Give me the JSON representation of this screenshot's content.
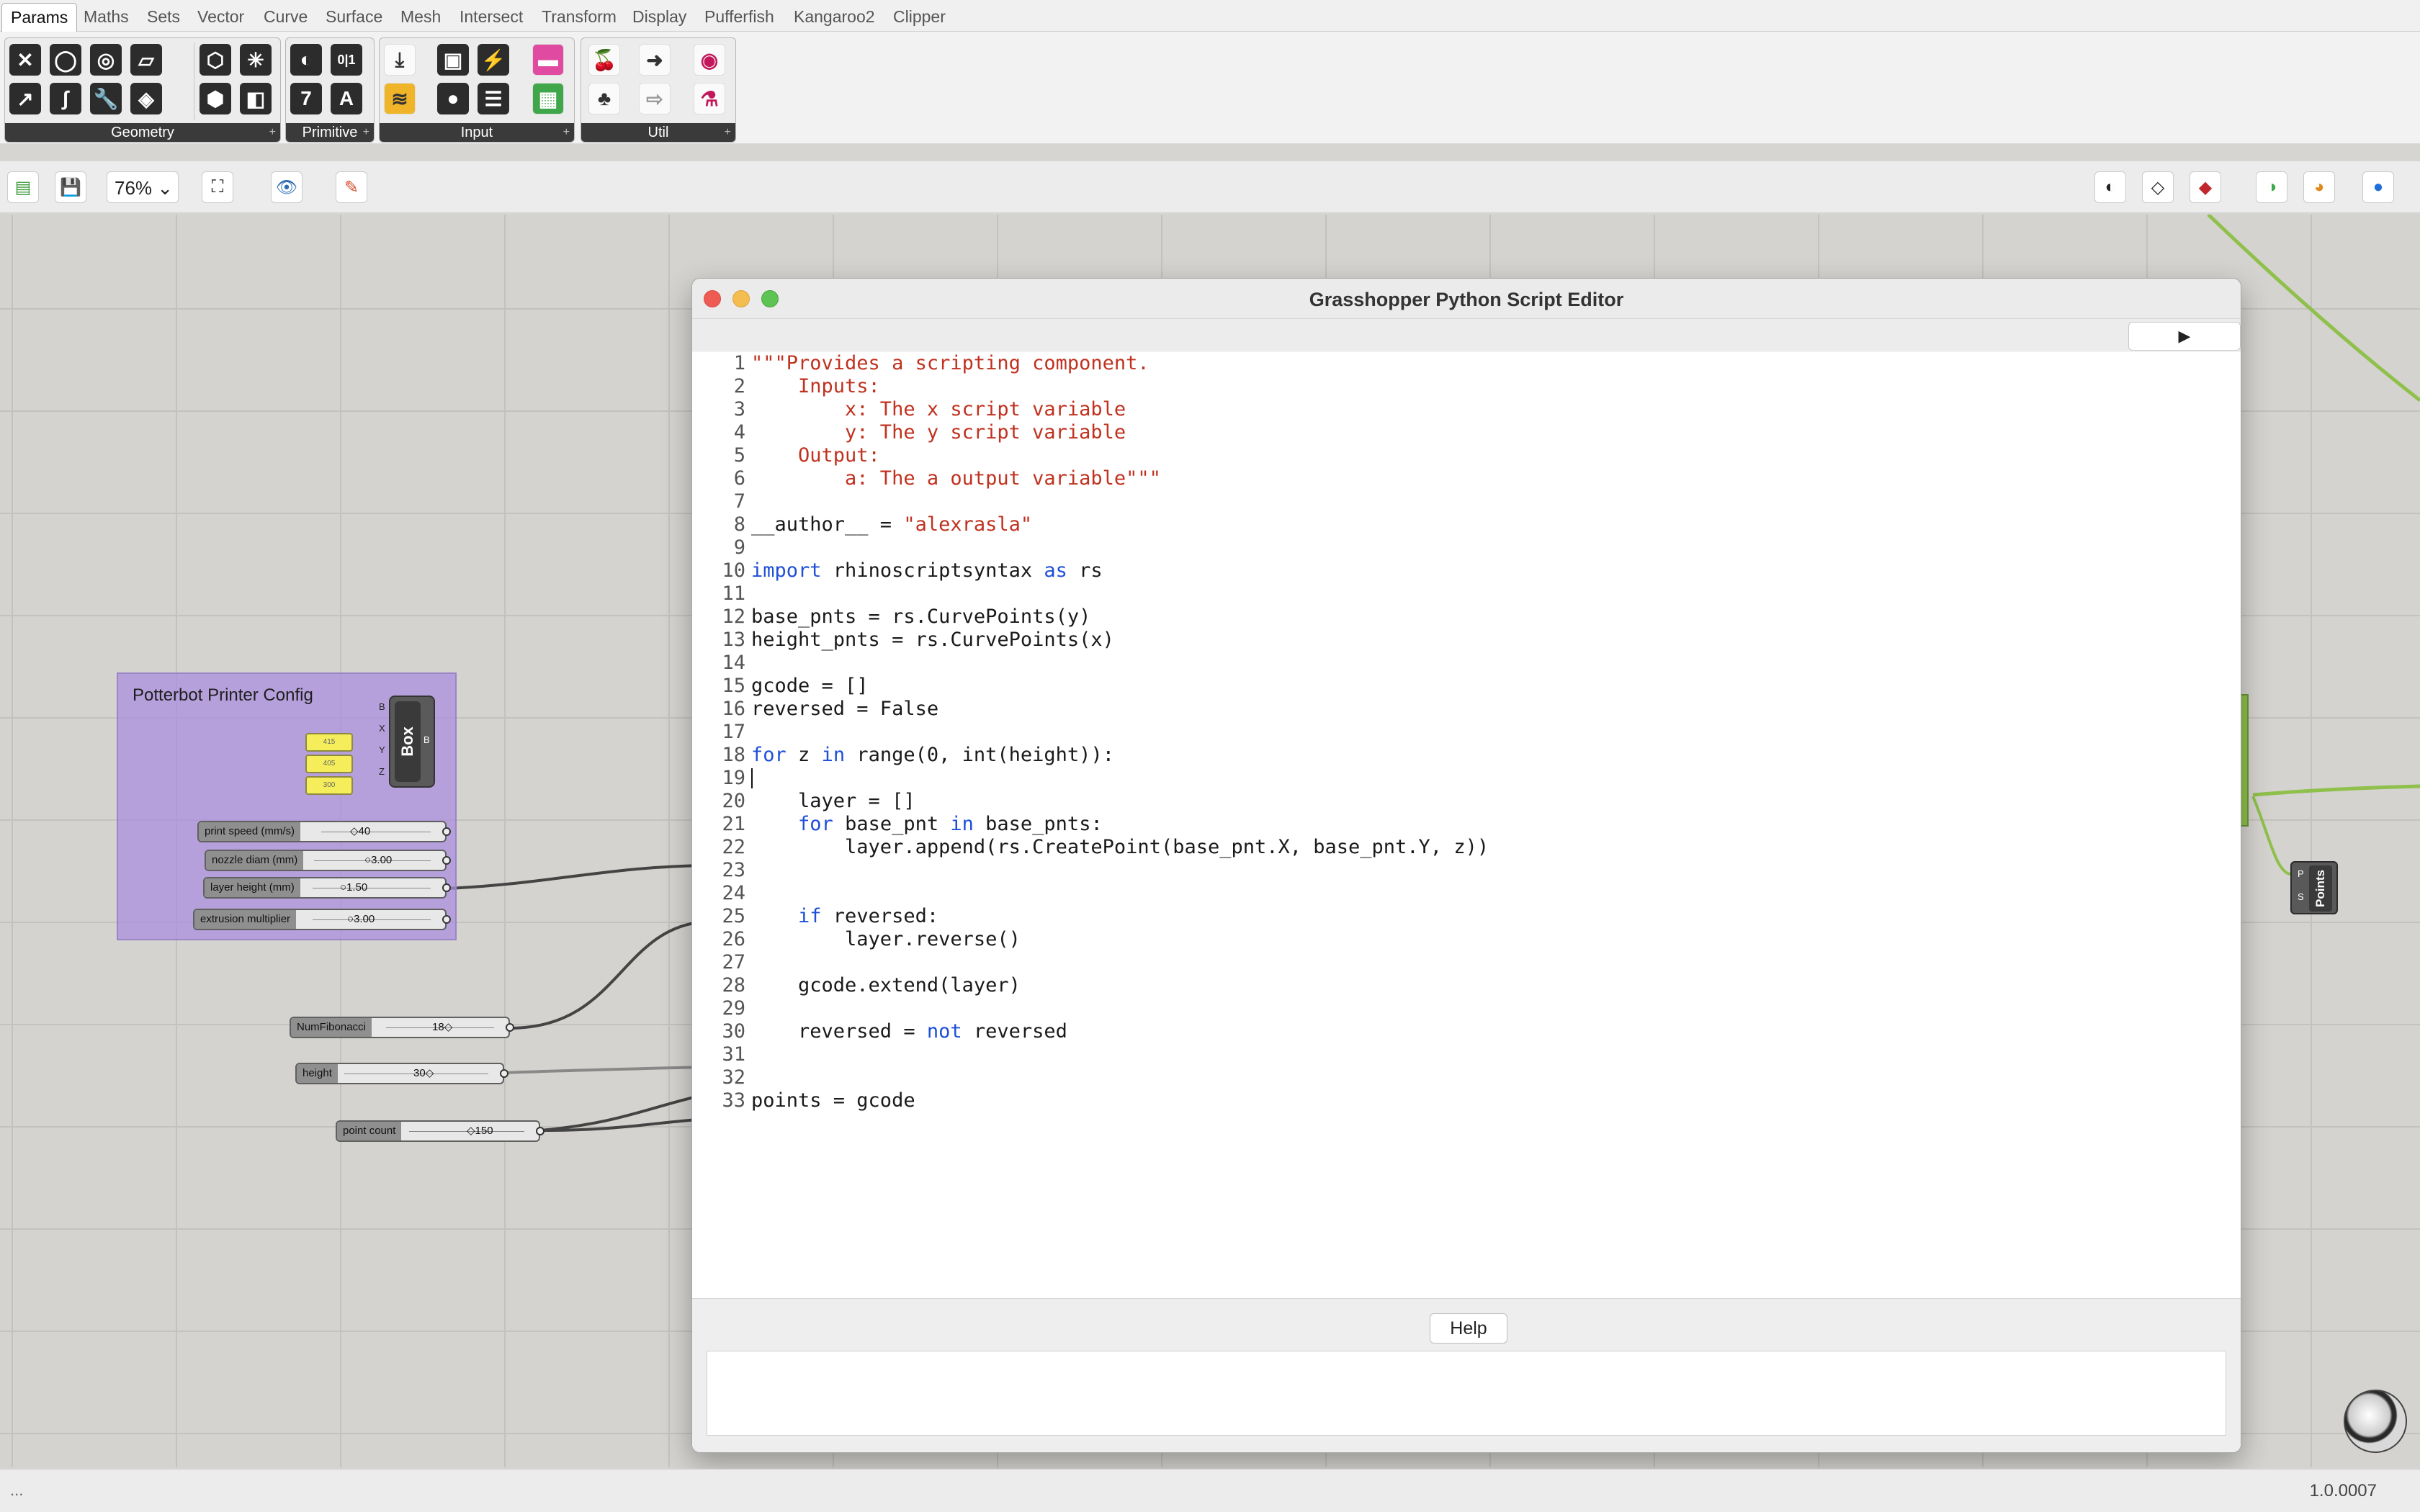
{
  "menu_tabs": [
    "Params",
    "Maths",
    "Sets",
    "Vector",
    "Curve",
    "Surface",
    "Mesh",
    "Intersect",
    "Transform",
    "Display",
    "Pufferfish",
    "Kangaroo2",
    "Clipper"
  ],
  "ribbon_groups": [
    "Geometry",
    "Primitive",
    "Input",
    "Util"
  ],
  "primitive_glyphs": [
    "0|1",
    "7",
    "A"
  ],
  "toolbar": {
    "zoom": "76%"
  },
  "canvas": {
    "group_title": "Potterbot Printer Config",
    "box_component": "Box",
    "box_inputs": [
      "B",
      "X",
      "Y",
      "Z"
    ],
    "box_output": "B",
    "yellow_values": [
      "415",
      "405",
      "300"
    ],
    "sliders": [
      {
        "label": "print speed (mm/s)",
        "value": "40"
      },
      {
        "label": "nozzle diam (mm)",
        "value": "3.00"
      },
      {
        "label": "layer height (mm)",
        "value": "1.50"
      },
      {
        "label": "extrusion multiplier",
        "value": "3.00"
      },
      {
        "label": "NumFibonacci",
        "value": "18"
      },
      {
        "label": "height",
        "value": "30"
      },
      {
        "label": "point count",
        "value": "150"
      }
    ],
    "points_component": "Points",
    "points_inputs": [
      "P",
      "S"
    ]
  },
  "editor": {
    "title": "Grasshopper Python Script Editor",
    "run_label": "▶",
    "code_lines": [
      "\"\"\"Provides a scripting component.",
      "    Inputs:",
      "        x: The x script variable",
      "        y: The y script variable",
      "    Output:",
      "        a: The a output variable\"\"\"",
      "",
      "__author__ = \"alexrasla\"",
      "",
      "import rhinoscriptsyntax as rs",
      "",
      "base_pnts = rs.CurvePoints(y)",
      "height_pnts = rs.CurvePoints(x)",
      "",
      "gcode = []",
      "reversed = False",
      "",
      "for z in range(0, int(height)):",
      "",
      "    layer = []",
      "    for base_pnt in base_pnts:",
      "        layer.append(rs.CreatePoint(base_pnt.X, base_pnt.Y, z))",
      "",
      "",
      "    if reversed:",
      "        layer.reverse()",
      "",
      "    gcode.extend(layer)",
      "",
      "    reversed = not reversed",
      "",
      "",
      "points = gcode"
    ],
    "help_label": "Help"
  },
  "status": {
    "left": "...",
    "version": "1.0.0007"
  },
  "colors": {
    "group_fill": "#aa8ce1",
    "slider_label": "#8f8f8f",
    "string_red": "#c0321f",
    "keyword_blue": "#1f4fd8",
    "wire_green": "#8fc04b"
  }
}
